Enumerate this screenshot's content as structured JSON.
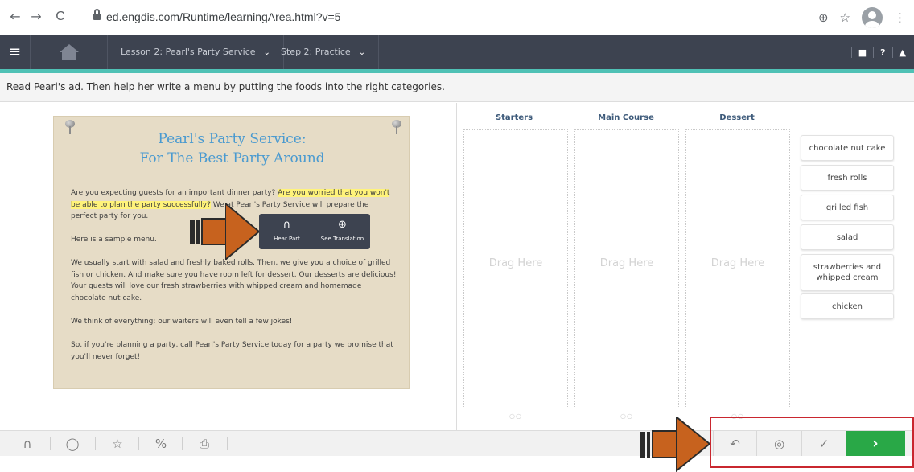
{
  "browser": {
    "url": "ed.engdis.com/Runtime/learningArea.html?v=5",
    "back_icon": "←",
    "forward_icon": "→",
    "reload_icon": "C",
    "zoom_icon": "⊕",
    "star_icon": "☆",
    "menu_icon": "⋮"
  },
  "header": {
    "menu_icon": "≡",
    "lesson_label": "Lesson 2: Pearl's Party Service",
    "step_label": "Step 2: Practice",
    "chevron": "⌄",
    "right_icons": [
      "■",
      "?",
      "▲"
    ]
  },
  "instruction": "Read Pearl's ad. Then help her write a menu by putting the foods into the right categories.",
  "ad": {
    "title_line1": "Pearl's Party Service:",
    "title_line2": "For The Best Party Around",
    "p1_a": "Are you expecting guests for an important dinner party? ",
    "p1_highlight": "Are you worried that you won't be able to plan the party successfully?",
    "p1_b": " We at Pearl's Party Service will prepare the perfect party for you.",
    "p2": "Here is a sample menu.",
    "p3": "We usually start with salad and freshly baked rolls. Then, we give you a choice of grilled fish or chicken. And make sure you have room left for dessert. Our desserts are delicious! Your guests will love our fresh strawberries with whipped cream and homemade chocolate nut cake.",
    "p4": "We think of everything: our waiters will even tell a few jokes!",
    "p5": "So, if you're planning a party, call Pearl's Party Service today for a party we promise that you'll never forget!"
  },
  "popover": {
    "hear_icon": "∩",
    "hear_label": "Hear Part",
    "translate_icon": "⊕",
    "translate_label": "See Translation"
  },
  "columns": [
    {
      "header": "Starters",
      "placeholder": "Drag Here"
    },
    {
      "header": "Main Course",
      "placeholder": "Drag Here"
    },
    {
      "header": "Dessert",
      "placeholder": "Drag Here"
    }
  ],
  "column_dots": "○○",
  "word_bank": [
    "chocolate nut cake",
    "fresh rolls",
    "grilled fish",
    "salad",
    "strawberries and whipped cream",
    "chicken"
  ],
  "footer": {
    "headphones_icon": "∩",
    "chat_icon": "◯",
    "star_icon": "☆",
    "link_icon": "%",
    "print_icon": "⎙",
    "reset_icon": "↶",
    "eye_icon": "◎",
    "check_icon": "✓",
    "next_icon": "›"
  },
  "colors": {
    "header_bg": "#3d4350",
    "accent_teal": "#4fc1b5",
    "ad_paper": "#e6dcc6",
    "ad_title": "#4a9ad0",
    "highlight": "#fff37a",
    "next_green": "#29a847",
    "arrow_orange": "#c7621e",
    "annotation_red": "#c9272f"
  }
}
